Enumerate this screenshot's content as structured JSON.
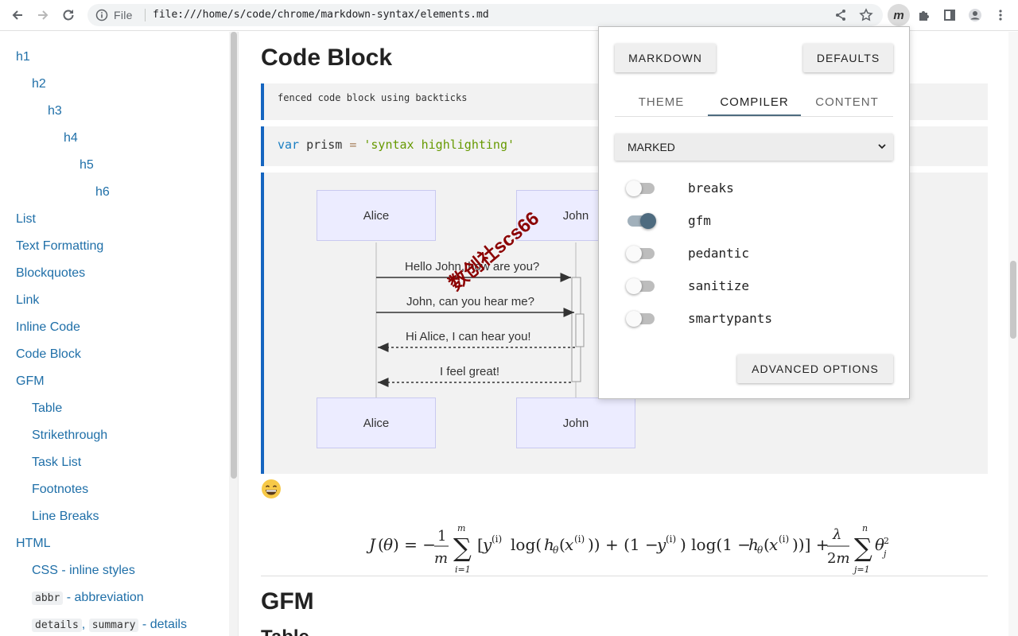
{
  "browser": {
    "scheme_label": "File",
    "url": "file:///home/s/code/chrome/markdown-syntax/elements.md",
    "extension_label": "m"
  },
  "sidebar": {
    "items": [
      {
        "label": "h1"
      },
      {
        "label": "h2"
      },
      {
        "label": "h3"
      },
      {
        "label": "h4"
      },
      {
        "label": "h5"
      },
      {
        "label": "h6"
      },
      {
        "label": "List"
      },
      {
        "label": "Text Formatting"
      },
      {
        "label": "Blockquotes"
      },
      {
        "label": "Link"
      },
      {
        "label": "Inline Code"
      },
      {
        "label": "Code Block"
      },
      {
        "label": "GFM"
      },
      {
        "label": "Table"
      },
      {
        "label": "Strikethrough"
      },
      {
        "label": "Task List"
      },
      {
        "label": "Footnotes"
      },
      {
        "label": "Line Breaks"
      },
      {
        "label": "HTML"
      },
      {
        "label": "CSS - inline styles"
      }
    ],
    "abbr": {
      "code": "abbr",
      "rest": " - abbreviation"
    },
    "details": {
      "code1": "details",
      "sep": ", ",
      "code2": "summary",
      "rest": " - details"
    }
  },
  "main": {
    "heading_code_block": "Code Block",
    "fenced_text": "fenced code block using backticks",
    "prism": {
      "kw": "var",
      "name": "prism",
      "op": "=",
      "str": "'syntax highlighting'"
    },
    "diagram": {
      "actor_top_left": "Alice",
      "actor_top_right": "John",
      "actor_bottom_left": "Alice",
      "actor_bottom_right": "John",
      "messages": [
        "Hello John, how are you?",
        "John, can you hear me?",
        "Hi Alice, I can hear you!",
        "I feel great!"
      ]
    },
    "watermark": "数创社scs66",
    "heading_gfm": "GFM",
    "heading_table": "Table"
  },
  "popup": {
    "markdown_button": "MARKDOWN",
    "defaults_button": "DEFAULTS",
    "tabs": [
      "THEME",
      "COMPILER",
      "CONTENT"
    ],
    "active_tab": "COMPILER",
    "compiler_value": "MARKED",
    "options": [
      {
        "label": "breaks",
        "on": false
      },
      {
        "label": "gfm",
        "on": true
      },
      {
        "label": "pedantic",
        "on": false
      },
      {
        "label": "sanitize",
        "on": false
      },
      {
        "label": "smartypants",
        "on": false
      }
    ],
    "advanced_button": "ADVANCED OPTIONS"
  }
}
